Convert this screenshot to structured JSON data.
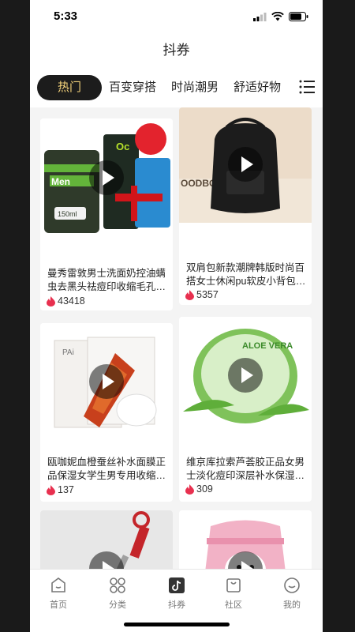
{
  "status": {
    "time": "5:33"
  },
  "nav": {
    "title": "抖券"
  },
  "tabs": [
    "热门",
    "百变穿搭",
    "时尚潮男",
    "舒适好物"
  ],
  "products": [
    {
      "title": "曼秀雷敦男士洗面奶控油螨虫去黑头祛痘印收缩毛孔…",
      "likes": "43418"
    },
    {
      "title": "双肩包新款潮牌韩版时尚百搭女士休闲pu软皮小背包…",
      "likes": "5357"
    },
    {
      "title": "瓯咖妮血橙蚕丝补水面膜正品保湿女学生男专用收缩…",
      "likes": "137"
    },
    {
      "title": "维京库拉索芦荟胶正品女男士淡化痘印深层补水保湿…",
      "likes": "309"
    }
  ],
  "image_texts": {
    "mentholatum": "Men",
    "oc": "Oc",
    "ml": "150ml",
    "doodbo": "OODBO",
    "aloe": "ALOE VERA",
    "pai": "PAi"
  },
  "bottom_nav": [
    "首页",
    "分类",
    "抖券",
    "社区",
    "我的"
  ],
  "colors": {
    "active_tab_bg": "#1c1c1c",
    "active_tab_text": "#f3d27a",
    "flame": "#e8304f"
  }
}
